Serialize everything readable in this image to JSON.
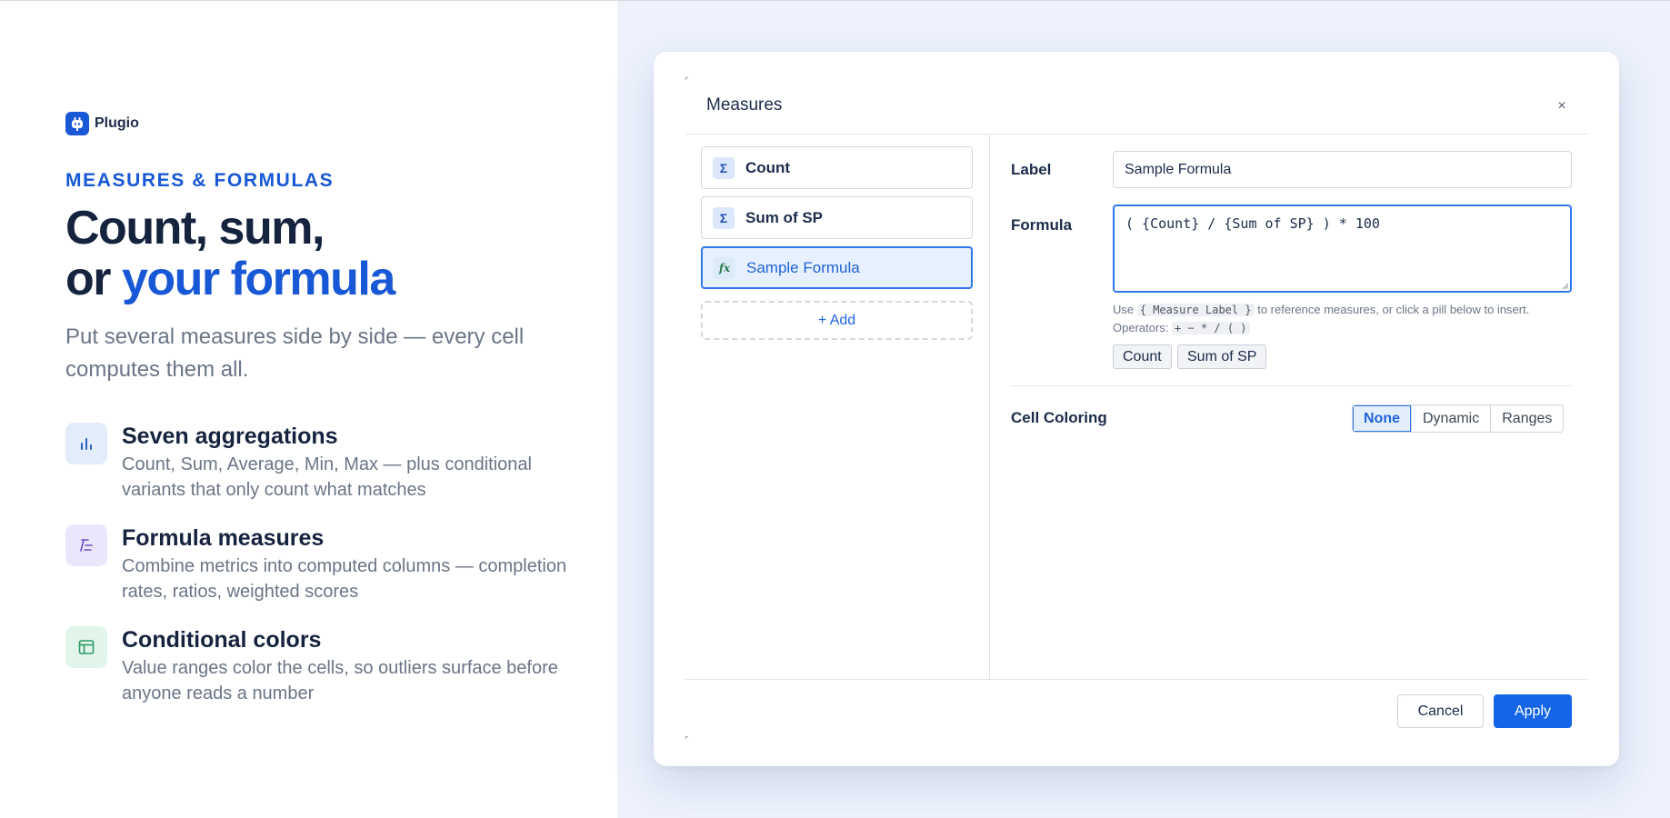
{
  "brand": {
    "name": "Plugio",
    "icon": "plug-icon",
    "color": "#1857d6"
  },
  "hero": {
    "eyebrow": "MEASURES & FORMULAS",
    "headline_line1": "Count, sum,",
    "headline_line2_prefix": "or ",
    "headline_line2_accent": "your formula",
    "subtitle": "Put several measures side by side — every cell computes them all."
  },
  "features": [
    {
      "icon": "bar-chart-icon",
      "title": "Seven aggregations",
      "desc": "Count, Sum, Average, Min, Max — plus conditional variants that only count what matches"
    },
    {
      "icon": "formula-icon",
      "title": "Formula measures",
      "desc": "Combine metrics into computed columns — completion rates, ratios, weighted scores"
    },
    {
      "icon": "table-icon",
      "title": "Conditional colors",
      "desc": "Value ranges color the cells, so outliers surface before anyone reads a number"
    }
  ],
  "dialog": {
    "title": "Measures",
    "close": "×",
    "measures": [
      {
        "badge": "Σ",
        "label": "Count",
        "selected": false
      },
      {
        "badge": "Σ",
        "label": "Sum of SP",
        "selected": false
      },
      {
        "badge": "fx",
        "label": "Sample Formula",
        "selected": true
      }
    ],
    "add_label": "+ Add",
    "form": {
      "label_caption": "Label",
      "label_value": "Sample Formula",
      "formula_caption": "Formula",
      "formula_value": "( {Count} / {Sum of SP} ) * 100",
      "hint_use": "Use",
      "hint_chip": "{ Measure Label }",
      "hint_rest": "to reference measures, or click a pill below to insert.",
      "operators_label": "Operators:",
      "operators": "+ − * / ( )",
      "pills": [
        "Count",
        "Sum of SP"
      ],
      "coloring_caption": "Cell Coloring",
      "coloring_options": [
        "None",
        "Dynamic",
        "Ranges"
      ],
      "coloring_selected": "None"
    },
    "footer": {
      "cancel": "Cancel",
      "apply": "Apply"
    }
  },
  "colors": {
    "accent": "#1857d6",
    "primary_button": "#1466e6",
    "right_bg": "#edf2fd"
  }
}
